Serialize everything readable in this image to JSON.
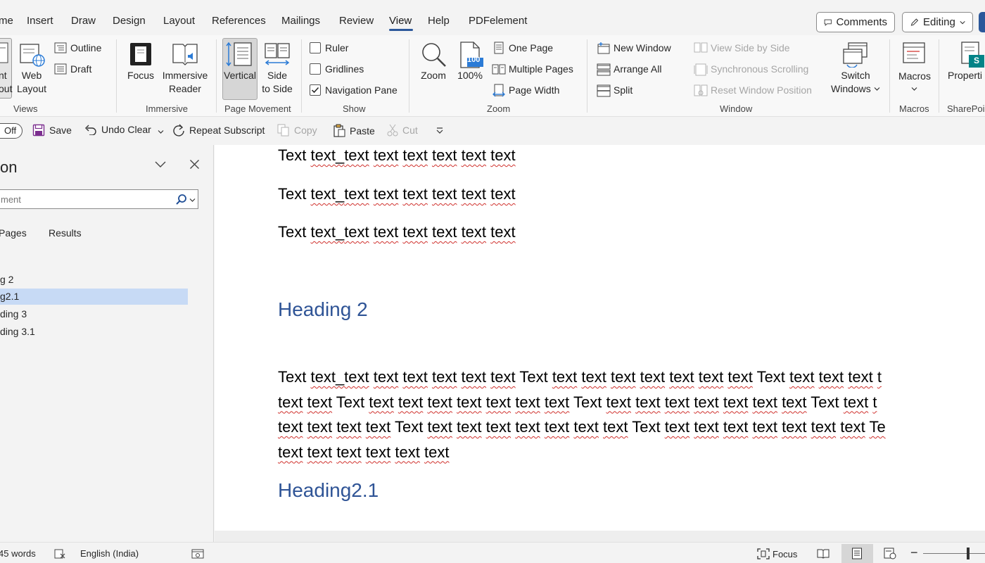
{
  "tabs": [
    {
      "label": "me",
      "active": false
    },
    {
      "label": "Insert",
      "active": false
    },
    {
      "label": "Draw",
      "active": false
    },
    {
      "label": "Design",
      "active": false
    },
    {
      "label": "Layout",
      "active": false
    },
    {
      "label": "References",
      "active": false
    },
    {
      "label": "Mailings",
      "active": false
    },
    {
      "label": "Review",
      "active": false
    },
    {
      "label": "View",
      "active": true
    },
    {
      "label": "Help",
      "active": false
    },
    {
      "label": "PDFelement",
      "active": false
    }
  ],
  "top_right": {
    "comments_label": "Comments",
    "editing_label": "Editing"
  },
  "ribbon": {
    "views": {
      "print_layout_partial": [
        "nt",
        "out"
      ],
      "web_layout": [
        "Web",
        "Layout"
      ],
      "outline": "Outline",
      "draft": "Draft",
      "group": "Views"
    },
    "immersive": {
      "focus": "Focus",
      "immersive_reader": [
        "Immersive",
        "Reader"
      ],
      "group": "Immersive"
    },
    "page_movement": {
      "vertical": "Vertical",
      "side_to_side": [
        "Side",
        "to Side"
      ],
      "group": "Page Movement"
    },
    "show": {
      "ruler": {
        "label": "Ruler",
        "checked": false
      },
      "gridlines": {
        "label": "Gridlines",
        "checked": false
      },
      "navigation_pane": {
        "label": "Navigation Pane",
        "checked": true
      },
      "group": "Show"
    },
    "zoom": {
      "zoom": "Zoom",
      "hundred_badge": "100",
      "hundred": "100%",
      "one_page": "One Page",
      "multiple_pages": "Multiple Pages",
      "page_width": "Page Width",
      "group": "Zoom"
    },
    "window": {
      "new_window": "New Window",
      "arrange_all": "Arrange All",
      "split": "Split",
      "view_side_by_side": "View Side by Side",
      "synchronous_scrolling": "Synchronous Scrolling",
      "reset_window_position": "Reset Window Position",
      "switch_windows": [
        "Switch",
        "Windows"
      ],
      "group": "Window"
    },
    "macros": {
      "label": "Macros",
      "group": "Macros"
    },
    "sharepoint": {
      "properties": "Properti",
      "group": "SharePoi",
      "badge": "S"
    }
  },
  "qat": {
    "autosave_state": "Off",
    "save": "Save",
    "undo": "Undo Clear",
    "repeat": "Repeat Subscript",
    "copy": "Copy",
    "paste": "Paste",
    "cut": "Cut"
  },
  "nav_pane": {
    "title": "on",
    "search_placeholder": "ment",
    "tabs": [
      "Pages",
      "Results"
    ],
    "items": [
      {
        "label": "g 2",
        "selected": false
      },
      {
        "label": "g2.1",
        "selected": true
      },
      {
        "label": "ding 3",
        "selected": false
      },
      {
        "label": "ding 3.1",
        "selected": false
      }
    ]
  },
  "document": {
    "lines_top": [
      [
        "Text",
        "text_",
        "text",
        "text",
        "text",
        "text",
        "text",
        "text"
      ],
      [
        "Text",
        "text_",
        "text",
        "text",
        "text",
        "text",
        "text",
        "text"
      ],
      [
        "Text",
        "text_",
        "text",
        "text",
        "text",
        "text",
        "text",
        "text"
      ]
    ],
    "heading_a": "Heading 2",
    "paragraph_lines": [
      "Text text_text text text text text text Text text  text text text text text text Text text  text text t",
      "text text Text text  text text text text text text Text text  text text text text text text Text text  t",
      "text text text text Text text  text text text text text text Text text  text text text text text text Te",
      "text text text text text text"
    ],
    "heading_b": "Heading2.1"
  },
  "status_bar": {
    "words": "45 words",
    "language": "English (India)",
    "focus": "Focus"
  },
  "colors": {
    "accent": "#2b579a",
    "heading": "#2f5496",
    "nav_selected": "#c7daf5",
    "spell_squiggle": "#d0312d"
  }
}
